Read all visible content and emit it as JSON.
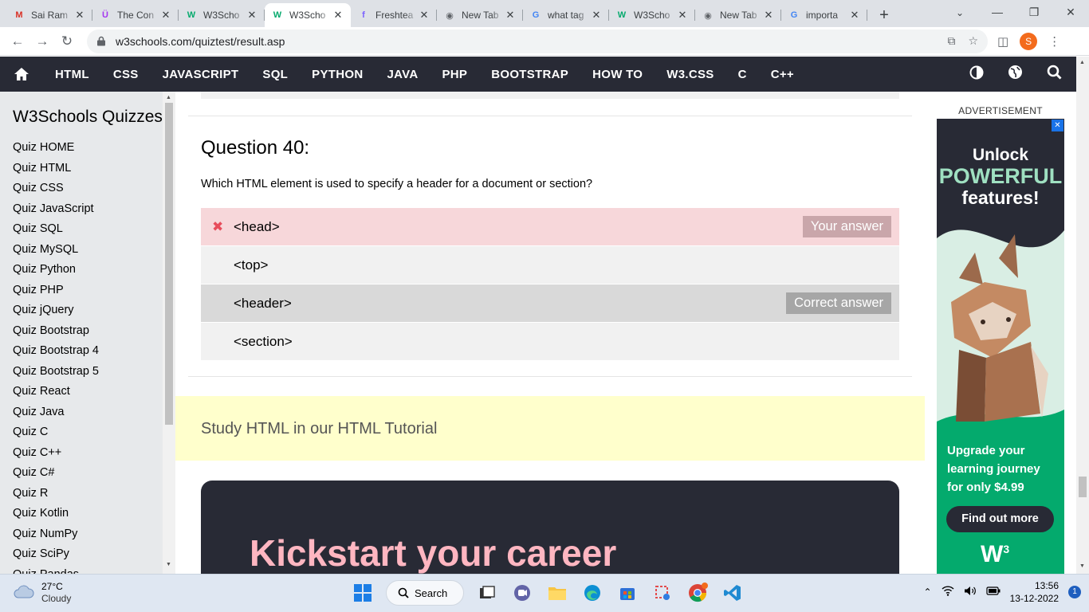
{
  "browser": {
    "tabs": [
      {
        "title": "Sai Ram",
        "favicon": "gmail-icon",
        "color": "#d93025"
      },
      {
        "title": "The Con",
        "favicon": "udemy-icon",
        "color": "#a435f0"
      },
      {
        "title": "W3Scho",
        "favicon": "w3schools-icon",
        "color": "#04aa6d"
      },
      {
        "title": "W3Scho",
        "favicon": "w3schools-icon",
        "color": "#04aa6d",
        "active": true
      },
      {
        "title": "Freshtea",
        "favicon": "freshteam-icon",
        "color": "#7b61ff"
      },
      {
        "title": "New Tab",
        "favicon": "chrome-icon",
        "color": "#5f6368"
      },
      {
        "title": "what tag",
        "favicon": "google-icon",
        "color": "#4285f4"
      },
      {
        "title": "W3Scho",
        "favicon": "w3schools-icon",
        "color": "#04aa6d"
      },
      {
        "title": "New Tab",
        "favicon": "chrome-icon",
        "color": "#5f6368"
      },
      {
        "title": "importa",
        "favicon": "google-icon",
        "color": "#4285f4"
      }
    ],
    "url": "w3schools.com/quiztest/result.asp",
    "profile_initial": "S"
  },
  "topnav": {
    "items": [
      "HTML",
      "CSS",
      "JAVASCRIPT",
      "SQL",
      "PYTHON",
      "JAVA",
      "PHP",
      "BOOTSTRAP",
      "HOW TO",
      "W3.CSS",
      "C",
      "C++"
    ]
  },
  "sidebar": {
    "title": "W3Schools Quizzes",
    "items": [
      "Quiz HOME",
      "Quiz HTML",
      "Quiz CSS",
      "Quiz JavaScript",
      "Quiz SQL",
      "Quiz MySQL",
      "Quiz Python",
      "Quiz PHP",
      "Quiz jQuery",
      "Quiz Bootstrap",
      "Quiz Bootstrap 4",
      "Quiz Bootstrap 5",
      "Quiz React",
      "Quiz Java",
      "Quiz C",
      "Quiz C++",
      "Quiz C#",
      "Quiz R",
      "Quiz Kotlin",
      "Quiz NumPy",
      "Quiz SciPy",
      "Quiz Pandas"
    ]
  },
  "question": {
    "title": "Question 40:",
    "text": "Which HTML element is used to specify a header for a document or section?",
    "answers": [
      {
        "text": "<head>",
        "status": "wrong",
        "tag": "Your answer"
      },
      {
        "text": "<top>",
        "status": "plain",
        "tag": ""
      },
      {
        "text": "<header>",
        "status": "correct",
        "tag": "Correct answer"
      },
      {
        "text": "<section>",
        "status": "plain",
        "tag": ""
      }
    ]
  },
  "study": {
    "text": "Study HTML in our HTML Tutorial"
  },
  "career": {
    "headline": "Kickstart your career"
  },
  "ad": {
    "label": "ADVERTISEMENT",
    "line1": "Unlock",
    "line2": "POWERFUL",
    "line3": "features!",
    "upgrade": "Upgrade your learning journey for only $4.99",
    "button": "Find out more",
    "logo": "W",
    "logo_sup": "3"
  },
  "taskbar": {
    "temp": "27°C",
    "condition": "Cloudy",
    "search": "Search",
    "time": "13:56",
    "date": "13-12-2022",
    "notifications": "1"
  }
}
